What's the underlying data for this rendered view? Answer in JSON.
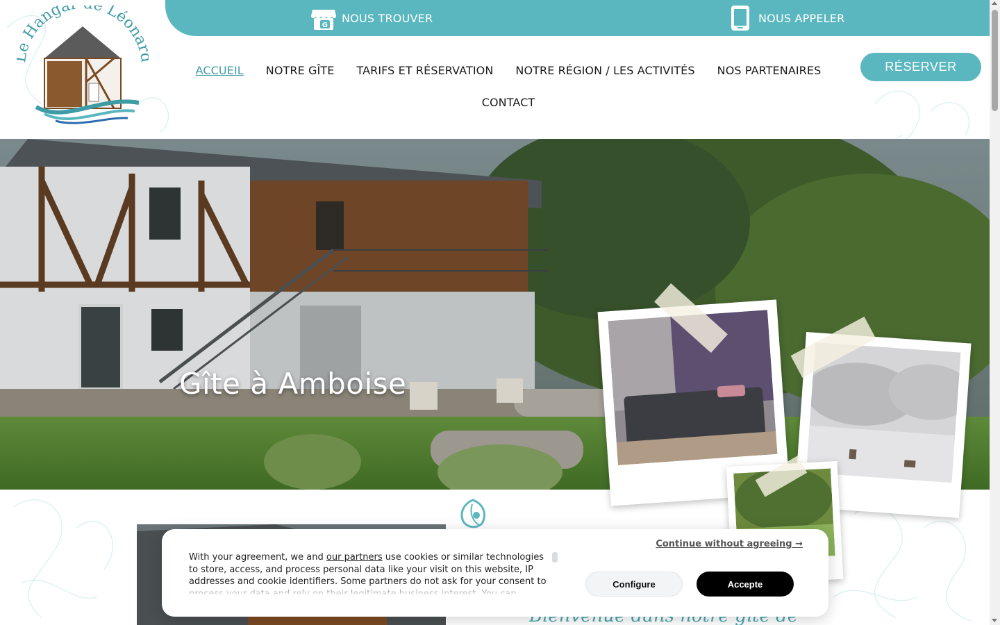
{
  "header": {
    "find_label": "NOUS TROUVER",
    "call_label": "NOUS APPELER",
    "logo_text": "Le Hangar de Léonard"
  },
  "nav": {
    "items": [
      {
        "label": "ACCUEIL",
        "active": true
      },
      {
        "label": "NOTRE GÎTE"
      },
      {
        "label": "TARIFS ET RÉSERVATION"
      },
      {
        "label": "NOTRE RÉGION / LES ACTIVITÉS"
      },
      {
        "label": "NOS PARTENAIRES"
      },
      {
        "label": "CONTACT"
      }
    ],
    "reserve_label": "RÉSERVER"
  },
  "hero": {
    "title": "Gîte à Amboise"
  },
  "welcome": {
    "heading": "Bienvenue dans notre gîte de"
  },
  "cookie": {
    "text_before": "With your agreement, we and",
    "partners_link": "our partners",
    "text_after": "use cookies or similar technologies to store, access, and process personal data like your visit on this website, IP addresses and cookie identifiers. Some partners do not ask for your consent to process your data and rely on their legitimate business interest. You can",
    "continue_label": "Continue without agreeing →",
    "configure_label": "Configure",
    "accept_label": "Accepte"
  },
  "colors": {
    "teal": "#5ab7c0",
    "teal_dark": "#3e9ca6",
    "accept_bg": "#000000"
  },
  "icons": [
    "store-icon",
    "phone-icon",
    "leaf-icon"
  ]
}
